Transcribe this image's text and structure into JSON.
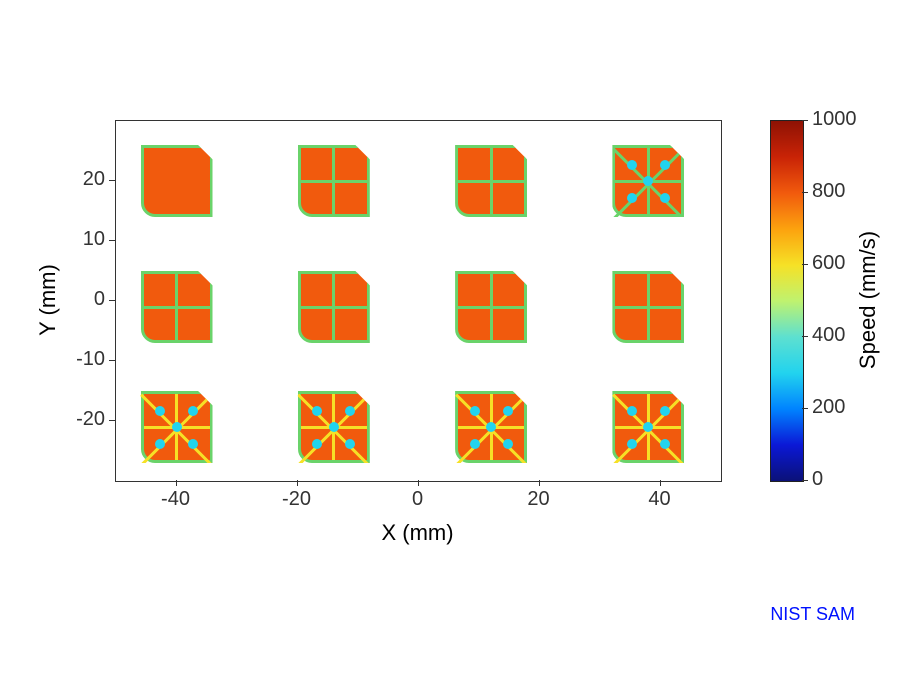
{
  "chart_data": {
    "type": "heatmap",
    "title": "",
    "xlabel": "X (mm)",
    "ylabel": "Y (mm)",
    "xlim": [
      -50,
      50
    ],
    "ylim": [
      -30,
      30
    ],
    "xticks": [
      -40,
      -20,
      0,
      20,
      40
    ],
    "yticks": [
      -20,
      -10,
      0,
      10,
      20
    ],
    "colorbar": {
      "label": "Speed (mm/s)",
      "min": 0,
      "max": 1000,
      "ticks": [
        0,
        200,
        400,
        600,
        800,
        1000
      ]
    },
    "samples": [
      {
        "cx": -40,
        "cy": 20,
        "pattern": "solid",
        "fill_speed": 800,
        "edge_speed": 550
      },
      {
        "cx": -14,
        "cy": 20,
        "pattern": "cross",
        "fill_speed": 800,
        "edge_speed": 550
      },
      {
        "cx": 12,
        "cy": 20,
        "pattern": "cross",
        "fill_speed": 800,
        "edge_speed": 550
      },
      {
        "cx": 38,
        "cy": 20,
        "pattern": "star",
        "fill_speed": 800,
        "edge_speed": 550
      },
      {
        "cx": -40,
        "cy": -1,
        "pattern": "cross",
        "fill_speed": 800,
        "edge_speed": 550
      },
      {
        "cx": -14,
        "cy": -1,
        "pattern": "cross",
        "fill_speed": 800,
        "edge_speed": 550
      },
      {
        "cx": 12,
        "cy": -1,
        "pattern": "cross",
        "fill_speed": 800,
        "edge_speed": 550
      },
      {
        "cx": 38,
        "cy": -1,
        "pattern": "cross",
        "fill_speed": 800,
        "edge_speed": 550
      },
      {
        "cx": -40,
        "cy": -21,
        "pattern": "star",
        "fill_speed": 800,
        "edge_speed": 620
      },
      {
        "cx": -14,
        "cy": -21,
        "pattern": "star",
        "fill_speed": 800,
        "edge_speed": 620
      },
      {
        "cx": 12,
        "cy": -21,
        "pattern": "star",
        "fill_speed": 800,
        "edge_speed": 620
      },
      {
        "cx": 38,
        "cy": -21,
        "pattern": "star",
        "fill_speed": 800,
        "edge_speed": 620
      }
    ],
    "attribution": "NIST SAM"
  }
}
